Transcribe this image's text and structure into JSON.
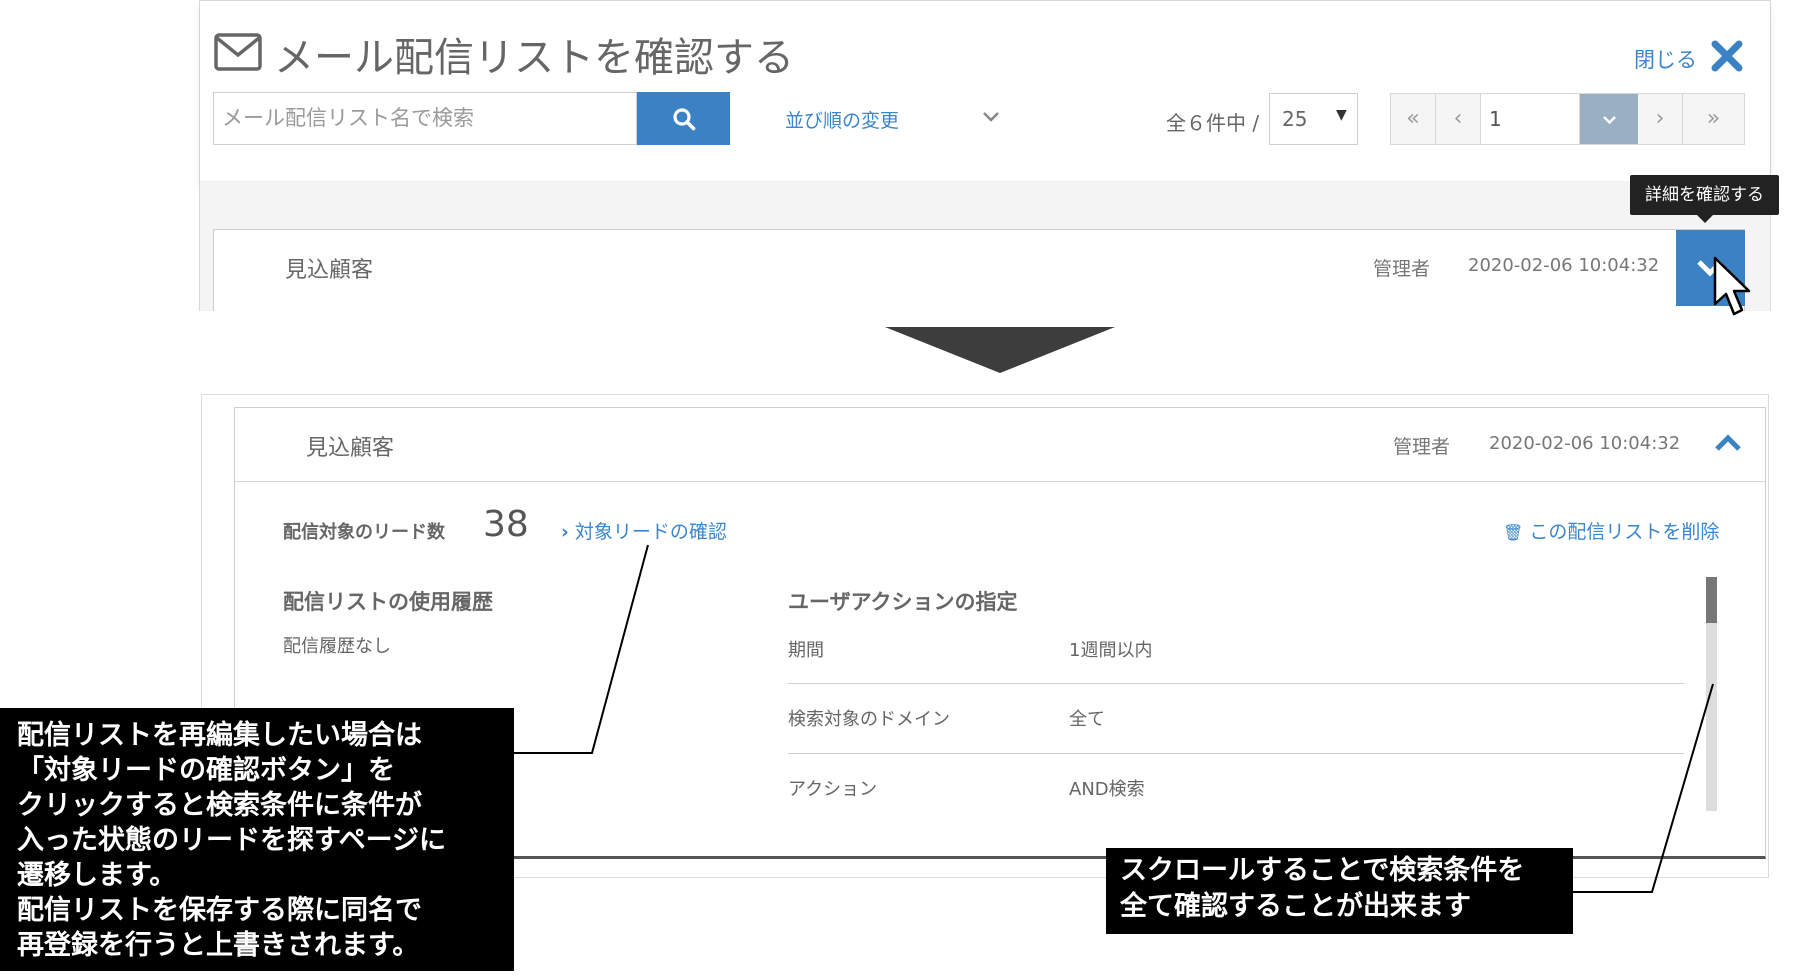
{
  "top": {
    "title": "メール配信リストを確認する",
    "close_label": "閉じる",
    "search_placeholder": "メール配信リスト名で検索",
    "sort_label": "並び順の変更",
    "count_text": "全６件中 /",
    "per_page": "25",
    "page": "1",
    "pager": {
      "first": "«",
      "prev": "‹",
      "next": "›",
      "last": "»"
    },
    "tooltip": "詳細を確認する",
    "row": {
      "title": "見込顧客",
      "owner": "管理者",
      "date": "2020-02-06 10:04:32"
    }
  },
  "detail": {
    "row": {
      "title": "見込顧客",
      "owner": "管理者",
      "date": "2020-02-06 10:04:32"
    },
    "lead_count_label": "配信対象のリード数",
    "lead_count": "38",
    "check_leads_link": "対象リードの確認",
    "delete_link": "この配信リストを削除",
    "history_heading": "配信リストの使用履歴",
    "history_value": "配信履歴なし",
    "action_heading": "ユーザアクションの指定",
    "conditions": [
      {
        "label": "期間",
        "value": "1週間以内"
      },
      {
        "label": "検索対象のドメイン",
        "value": "全て"
      },
      {
        "label": "アクション",
        "value": "AND検索"
      }
    ]
  },
  "annotations": {
    "left_lines": [
      "配信リストを再編集したい場合は",
      "「対象リードの確認ボタン」を",
      "クリックすると検索条件に条件が",
      "入った状態のリードを探すページに",
      "遷移します。",
      "配信リストを保存する際に同名で",
      "再登録を行うと上書きされます。"
    ],
    "right_lines": [
      "スクロールすることで検索条件を",
      "全て確認することが出来ます"
    ]
  },
  "colors": {
    "accent": "#3b82c4",
    "link": "#3c86cc",
    "callout_bg": "#000000"
  },
  "icons": [
    "envelope-icon",
    "close-x-icon",
    "search-icon",
    "chevron-down-icon",
    "chevron-up-icon",
    "mouse-cursor-icon",
    "trash-icon",
    "chevron-right-icon"
  ]
}
